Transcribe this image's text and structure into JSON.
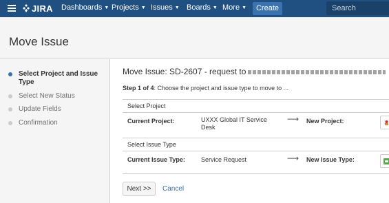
{
  "topbar": {
    "logo_text": "JIRA",
    "nav": [
      {
        "label": "Dashboards"
      },
      {
        "label": "Projects"
      },
      {
        "label": "Issues"
      },
      {
        "label": "Boards"
      },
      {
        "label": "More"
      }
    ],
    "create_label": "Create",
    "search_placeholder": "Search",
    "colors": {
      "bar": "#205081",
      "create": "#3b73af"
    }
  },
  "page": {
    "title": "Move Issue"
  },
  "sidebar": {
    "steps": [
      {
        "label": "Select Project and Issue Type",
        "active": true
      },
      {
        "label": "Select New Status",
        "active": false
      },
      {
        "label": "Update Fields",
        "active": false
      },
      {
        "label": "Confirmation",
        "active": false
      }
    ]
  },
  "main": {
    "heading": "Move Issue: SD-2607 - request to",
    "step_prefix": "Step 1 of 4",
    "step_text": ": Choose the project and issue type to move to ...",
    "select_project": {
      "section_label": "Select Project",
      "current_label": "Current Project:",
      "current_value": "UXXX Global IT Service Desk",
      "arrow": "⟶",
      "new_label": "New Project:",
      "new_icon": "project-avatar-icon"
    },
    "select_issue_type": {
      "section_label": "Select Issue Type",
      "current_label": "Current Issue Type:",
      "current_value": "Service Request",
      "arrow": "⟶",
      "new_label": "New Issue Type:",
      "new_icon": "service-request-icon"
    },
    "next_label": "Next >>",
    "cancel_label": "Cancel"
  }
}
